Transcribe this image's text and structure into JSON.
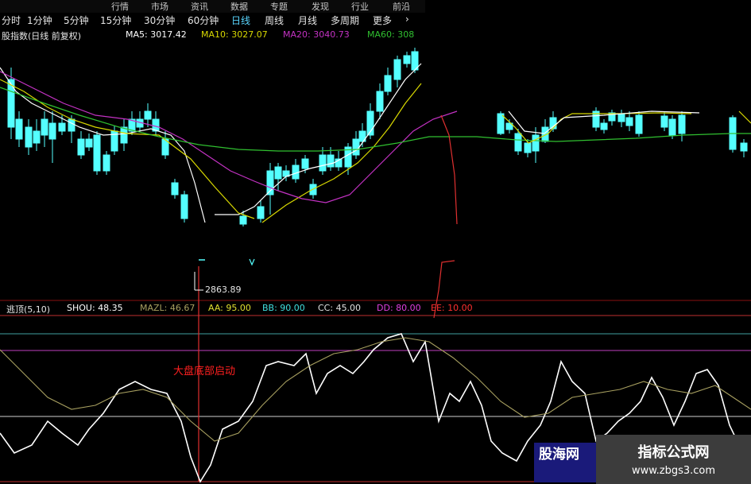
{
  "toolbar": {
    "tabs": [
      "分时",
      "1分钟",
      "5分钟",
      "15分钟",
      "30分钟",
      "60分钟",
      "日线",
      "周线",
      "月线",
      "多周期",
      "更多"
    ],
    "active": "日线",
    "arrow": "›",
    "menu": [
      "行情",
      "市场",
      "资讯",
      "数据",
      "专题",
      "发现",
      "行业",
      "前沿"
    ]
  },
  "ma": {
    "title": "股指数(日线 前复权)",
    "ma5": "MA5: 3017.42",
    "ma10": "MA10: 3027.07",
    "ma20": "MA20: 3040.73",
    "ma60": "MA60: 308"
  },
  "indicator": {
    "name": "逃顶(5,10)",
    "shou": "SHOU: 48.35",
    "mazl": "MAZL: 46.67",
    "aa": "AA: 95.00",
    "bb": "BB: 90.00",
    "cc": "CC: 45.00",
    "dd": "DD: 80.00",
    "ee": "EE: 10.00"
  },
  "annotations": {
    "low_price": "2863.89",
    "signal": "大盘底部启动"
  },
  "watermarks": {
    "left_title": "股海网",
    "right_title": "指标公式网",
    "right_url": "www.zbgs3.com"
  },
  "colors": {
    "up": "#ff3a3a",
    "down": "#54ffff",
    "ma5": "#ffffff",
    "ma10": "#d8d800",
    "ma20": "#c432c4",
    "ma60": "#30c030",
    "shou": "#ffffff",
    "mazl": "#a8a060",
    "signal": "#ff2020"
  }
}
